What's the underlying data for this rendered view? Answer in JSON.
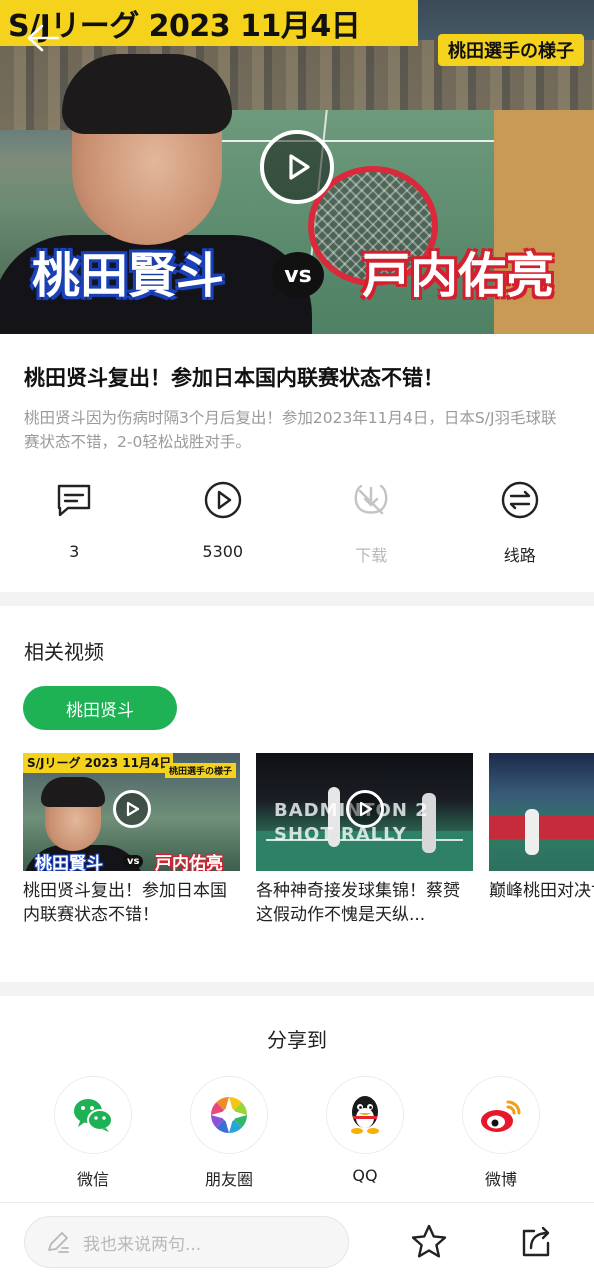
{
  "hero": {
    "banner_title": "S/Jリーグ 2023 11月4日",
    "banner_tag": "桃田選手の様子",
    "player_left": "桃田賢斗",
    "vs": "vs",
    "player_right": "戸内佑亮"
  },
  "video": {
    "title": "桃田贤斗复出！参加日本国内联赛状态不错！",
    "description": "桃田贤斗因为伤病时隔3个月后复出！参加2023年11月4日，日本S/J羽毛球联赛状态不错，2-0轻松战胜对手。"
  },
  "actions": [
    {
      "icon": "comment-icon",
      "label": "3"
    },
    {
      "icon": "play-count-icon",
      "label": "5300"
    },
    {
      "icon": "download-icon",
      "label": "下载"
    },
    {
      "icon": "route-icon",
      "label": "线路"
    }
  ],
  "related": {
    "heading": "相关视频",
    "chip": "桃田贤斗",
    "cards": [
      {
        "title": "桃田贤斗复出！参加日本国内联赛状态不错！",
        "thumb_banner": "S/Jリーグ 2023 11月4日",
        "thumb_tag": "桃田選手の様子",
        "thumb_left": "桃田賢斗",
        "thumb_vs": "vs",
        "thumb_right": "戸内佑亮"
      },
      {
        "title": "各种神奇接发球集锦！蔡赟这假动作不愧是天纵...",
        "thumb_text": "BADMINTON 2 SHOT RALLY"
      },
      {
        "title": "巅峰桃田对决世锦赛决赛"
      }
    ]
  },
  "share": {
    "heading": "分享到",
    "items": [
      {
        "icon": "wechat-icon",
        "label": "微信"
      },
      {
        "icon": "moments-icon",
        "label": "朋友圈"
      },
      {
        "icon": "qq-icon",
        "label": "QQ"
      },
      {
        "icon": "weibo-icon",
        "label": "微博"
      }
    ]
  },
  "bottom": {
    "comment_placeholder": "我也来说两句..."
  },
  "colors": {
    "accent_green": "#1fb255",
    "banner_yellow": "#f5d21c",
    "name_blue": "#1a44c4",
    "name_red": "#d4202e",
    "disabled_gray": "#b9b9b9"
  }
}
